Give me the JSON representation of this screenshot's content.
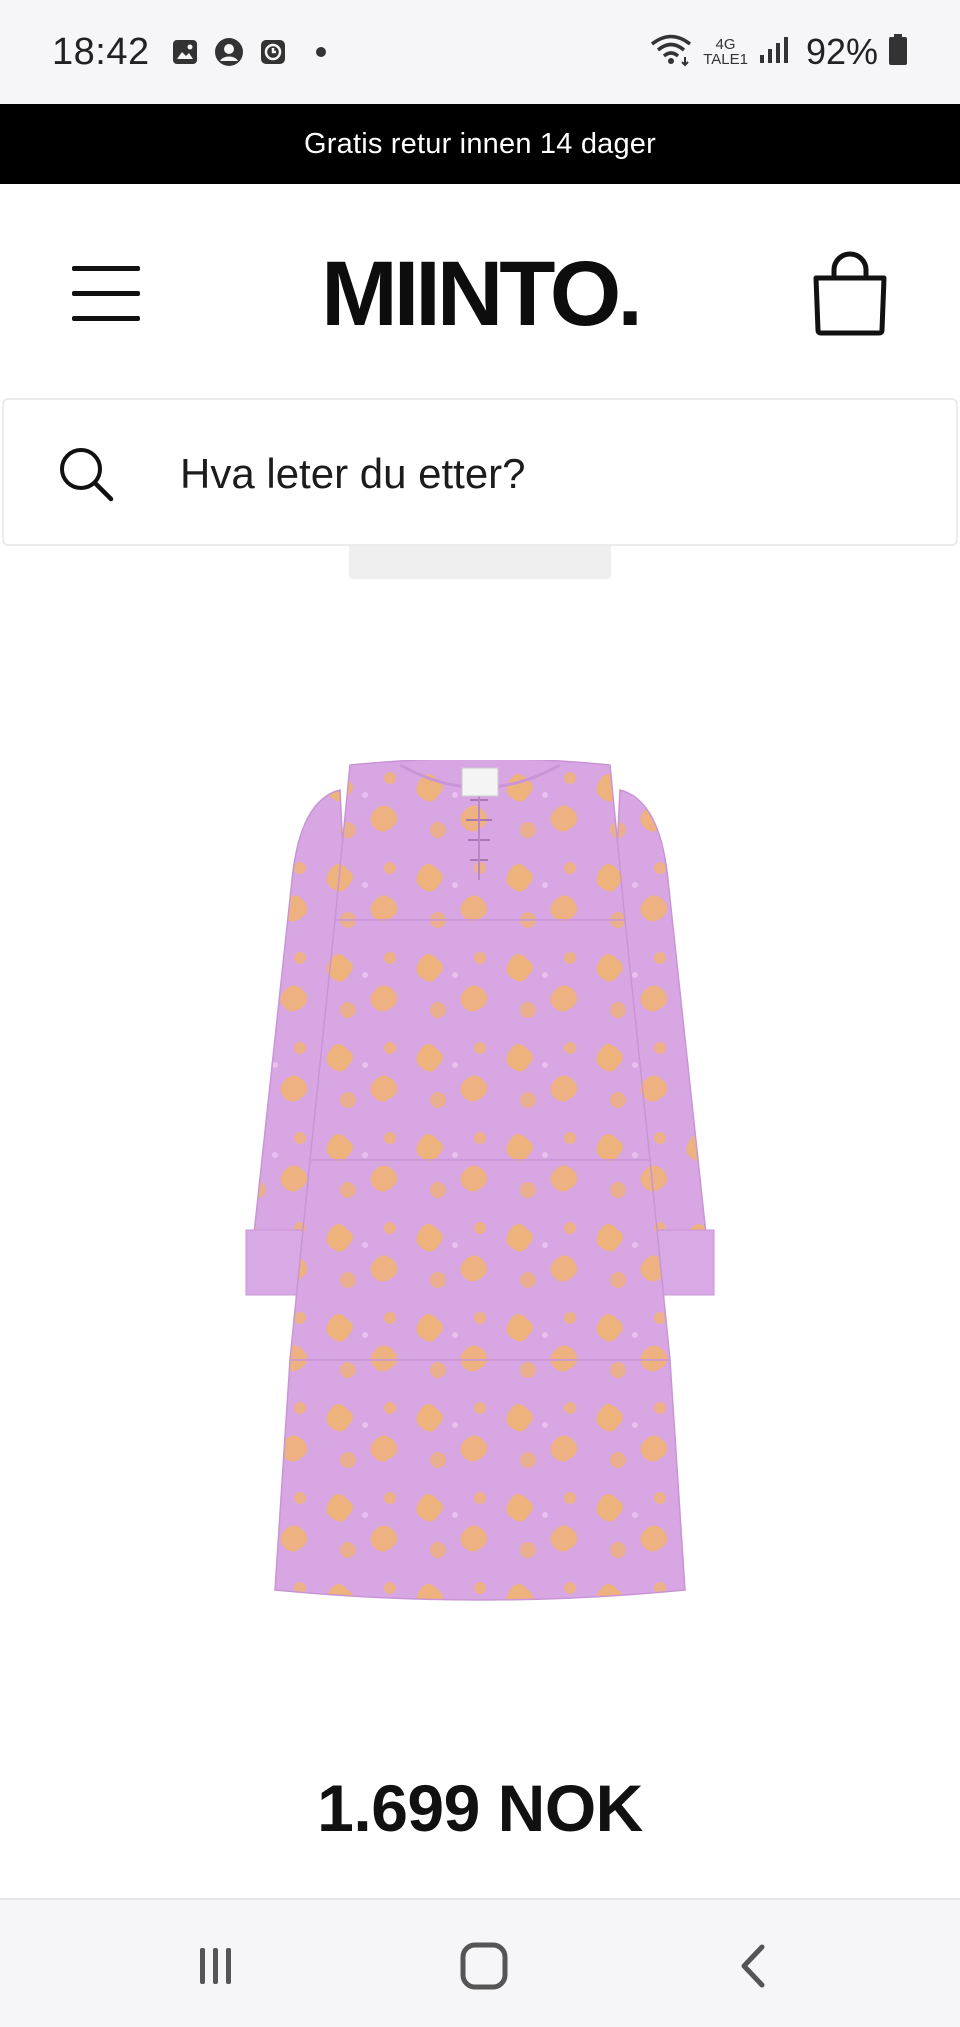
{
  "status_bar": {
    "time": "18:42",
    "icons_left": [
      "gallery-icon",
      "account-icon",
      "clock-app-icon",
      "dot-icon"
    ],
    "network_top": "4G",
    "network_bottom": "TALE1",
    "battery": "92%",
    "icons_right": [
      "wifi-icon",
      "signal-icon",
      "battery-icon"
    ]
  },
  "promo": {
    "text": "Gratis retur innen 14 dager"
  },
  "header": {
    "logo": "MIINTO.",
    "icons": [
      "hamburger-menu-icon",
      "shopping-bag-icon"
    ]
  },
  "search": {
    "placeholder": "Hva leter du etter?",
    "icon": "search-icon"
  },
  "product": {
    "image": "pink tiered long-sleeve dress with orange floral print",
    "price": "1.699 NOK"
  },
  "colors": {
    "promo_bg": "#000000",
    "dress_base": "#d7a6e3",
    "dress_print": "#f2b46a",
    "system_bar_bg": "#f6f6f8"
  },
  "nav_bar": {
    "icons": [
      "recent-apps-icon",
      "home-icon",
      "back-icon"
    ]
  }
}
